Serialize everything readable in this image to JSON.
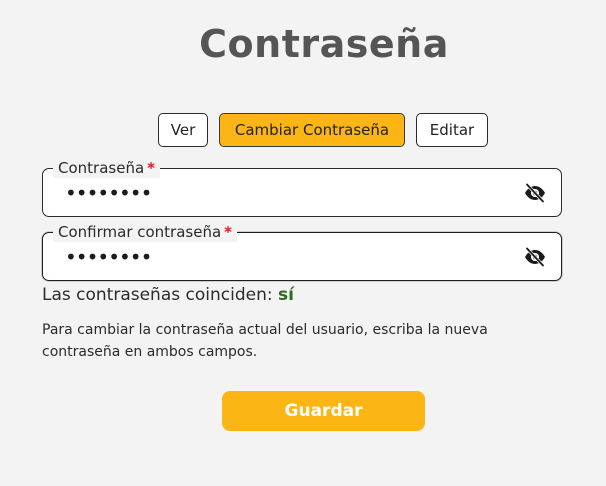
{
  "page": {
    "title": "Contraseña"
  },
  "tabs": [
    {
      "label": "Ver",
      "active": false
    },
    {
      "label": "Cambiar Contraseña",
      "active": true
    },
    {
      "label": "Editar",
      "active": false
    }
  ],
  "password_field": {
    "label": "Contraseña",
    "required_marker": "*",
    "value": "••••••••",
    "toggle_icon": "eye-slash-icon"
  },
  "confirm_field": {
    "label": "Confirmar contraseña",
    "required_marker": "*",
    "value": "••••••••",
    "toggle_icon": "eye-slash-icon"
  },
  "match": {
    "label": "Las contraseñas coinciden:",
    "value": "sí"
  },
  "help_text": "Para cambiar la contraseña actual del usuario, escriba la nueva contraseña en ambos campos.",
  "save_button": {
    "label": "Guardar"
  },
  "colors": {
    "accent": "#fbb616",
    "background": "#f3f3f4",
    "required": "#d21f1f",
    "match_ok": "#2e6b1f"
  }
}
